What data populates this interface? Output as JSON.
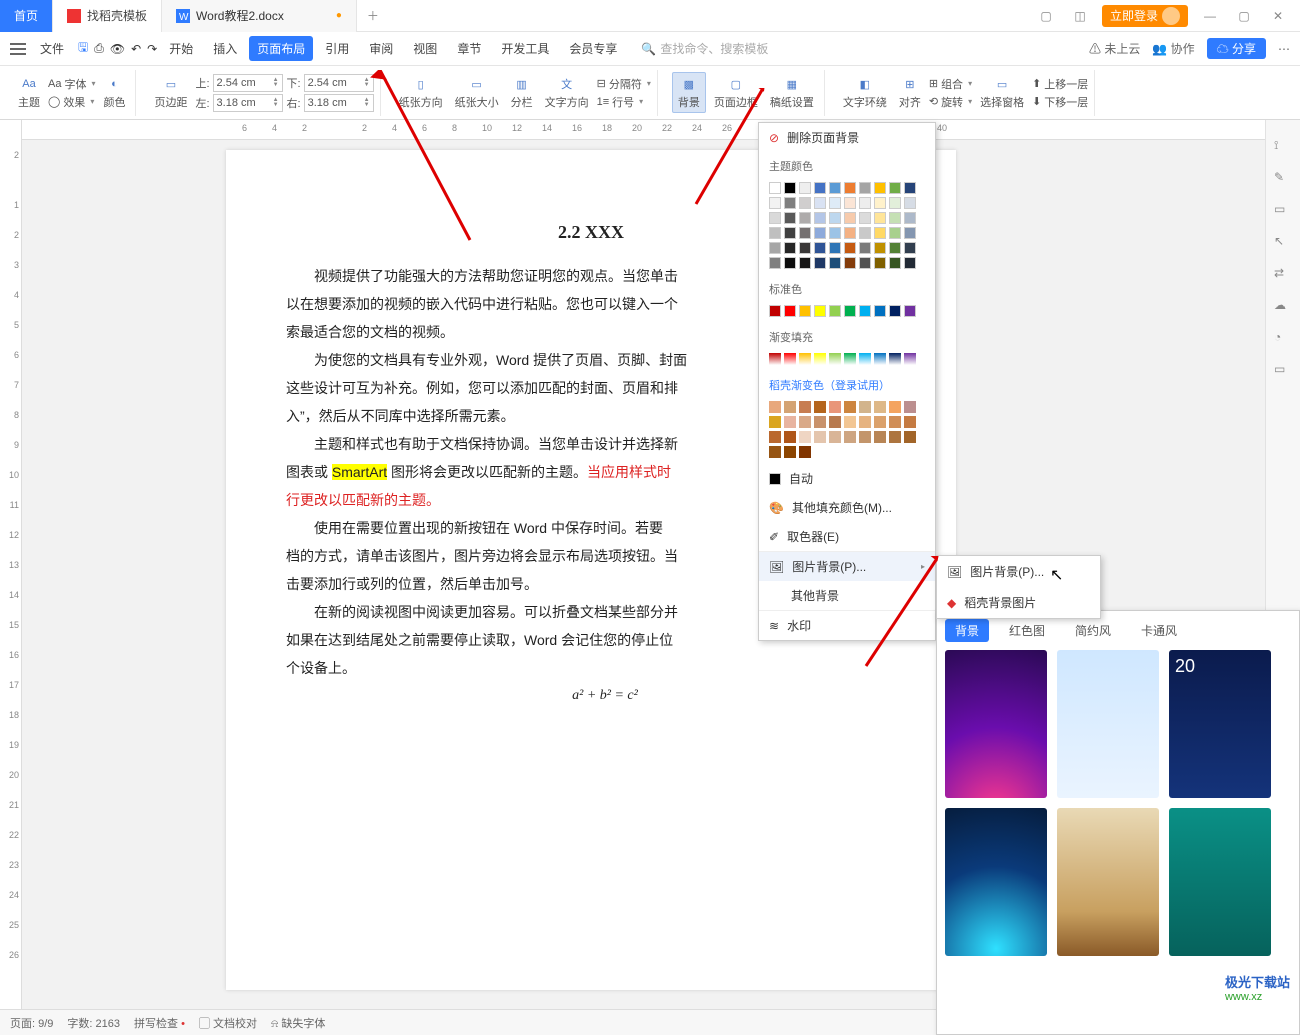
{
  "tabs": {
    "home": "首页",
    "template": "找稻壳模板",
    "doc": "Word教程2.docx"
  },
  "titlebar": {
    "login": "立即登录"
  },
  "menu": {
    "file": "文件",
    "start": "开始",
    "insert": "插入",
    "pagelayout": "页面布局",
    "reference": "引用",
    "review": "审阅",
    "view": "视图",
    "chapter": "章节",
    "devtool": "开发工具",
    "member": "会员专享"
  },
  "search": {
    "placeholder": "查找命令、搜索模板"
  },
  "menu_right": {
    "nosync": "未上云",
    "collab": "协作",
    "share": "分享"
  },
  "ribbon": {
    "theme": "主题",
    "font": "字体",
    "color": "颜色",
    "effect": "效果",
    "margin": "页边距",
    "top_label": "上:",
    "bottom_label": "下:",
    "left_label": "左:",
    "right_label": "右:",
    "top": "2.54 cm",
    "bottom": "2.54 cm",
    "left": "3.18 cm",
    "right": "3.18 cm",
    "orient": "纸张方向",
    "size": "纸张大小",
    "columns": "分栏",
    "textdir": "文字方向",
    "lineno": "行号",
    "breaks": "分隔符",
    "background": "背景",
    "border": "页面边框",
    "manuscript": "稿纸设置",
    "wrap": "文字环绕",
    "align": "对齐",
    "rotate": "旋转",
    "group_a": "组合",
    "selpane": "选择窗格",
    "bringfwd": "上移一层",
    "sendback": "下移一层"
  },
  "popup": {
    "remove": "删除页面背景",
    "theme_colors": "主题颜色",
    "standard": "标准色",
    "gradient": "渐变填充",
    "docer_grad": "稻壳渐变色（登录试用）",
    "auto": "自动",
    "more": "其他填充颜色(M)...",
    "eyedrop": "取色器(E)",
    "picbg": "图片背景(P)...",
    "otherbg": "其他背景",
    "watermark": "水印"
  },
  "submenu": {
    "picbg": "图片背景(P)...",
    "docerbg": "稻壳背景图片"
  },
  "bgpanel": {
    "tabs": [
      "背景",
      "红色图",
      "简约风",
      "卡通风"
    ]
  },
  "doc": {
    "heading": "2.2 XXX",
    "p1": "视频提供了功能强大的方法帮助您证明您的观点。当您单击",
    "p2": "以在想要添加的视频的嵌入代码中进行粘贴。您也可以键入一个",
    "p3": "索最适合您的文档的视频。",
    "p4": "为使您的文档具有专业外观，Word 提供了页眉、页脚、封面",
    "p5": "这些设计可互为补充。例如，您可以添加匹配的封面、页眉和排",
    "p6": "入”，然后从不同库中选择所需元素。",
    "p7a": "主题和样式也有助于文档保持协调。当您单击设计并选择新",
    "p7b": "图表或 ",
    "p7c": "SmartArt",
    "p7d": " 图形将会更改以匹配新的主题。",
    "p7e": "当应用样式时",
    "p7f": "行更改以匹配新的主题。",
    "p8": "使用在需要位置出现的新按钮在 Word 中保存时间。若要",
    "p9": "档的方式，请单击该图片，图片旁边将会显示布局选项按钮。当",
    "p10": "击要添加行或列的位置，然后单击加号。",
    "p11": "在新的阅读视图中阅读更加容易。可以折叠文档某些部分并",
    "p12": "如果在达到结尾处之前需要停止读取，Word 会记住您的停止位",
    "p13": "个设备上。",
    "formula": "a² + b² = c²"
  },
  "status": {
    "page": "页面: 9/9",
    "words": "字数: 2163",
    "spell": "拼写检查",
    "proof": "文档校对",
    "missing": "缺失字体"
  },
  "watermark": {
    "l1": "极光下载站",
    "l2": "www.xz"
  }
}
